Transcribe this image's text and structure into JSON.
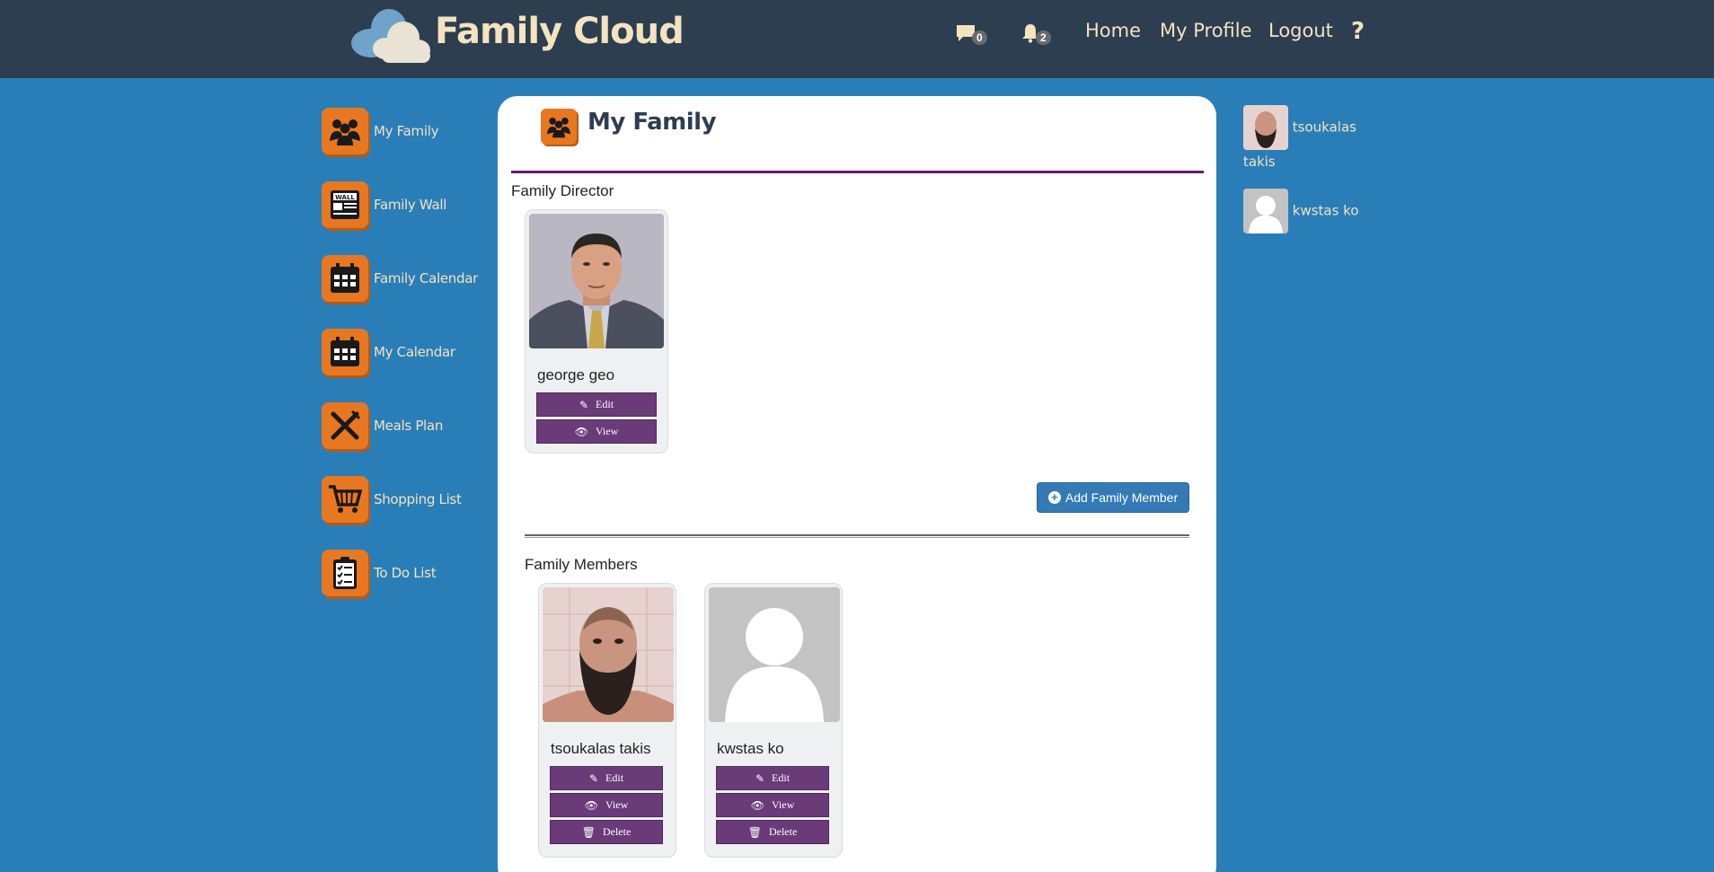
{
  "header": {
    "brand": "Family Cloud",
    "messages_count": "0",
    "notifications_count": "2",
    "nav": [
      "Home",
      "My Profile",
      "Logout"
    ],
    "help": "?"
  },
  "sidebar": {
    "items": [
      {
        "label": "My Family",
        "icon": "family-icon"
      },
      {
        "label": "Family Wall",
        "icon": "wall-icon"
      },
      {
        "label": "Family Calendar",
        "icon": "calendar-icon"
      },
      {
        "label": "My Calendar",
        "icon": "calendar-icon"
      },
      {
        "label": "Meals Plan",
        "icon": "utensils-icon"
      },
      {
        "label": "Shopping List",
        "icon": "cart-icon"
      },
      {
        "label": "To Do List",
        "icon": "checklist-icon"
      }
    ]
  },
  "main": {
    "title": "My Family",
    "director_label": "Family Director",
    "director": {
      "name": "george geo",
      "buttons": [
        "Edit",
        "View"
      ]
    },
    "add_member_label": "Add Family Member",
    "members_label": "Family Members",
    "members": [
      {
        "name": "tsoukalas takis",
        "buttons": [
          "Edit",
          "View",
          "Delete"
        ]
      },
      {
        "name": "kwstas ko",
        "buttons": [
          "Edit",
          "View",
          "Delete"
        ]
      }
    ]
  },
  "online": [
    {
      "first": "tsoukalas",
      "last": "takis"
    },
    {
      "first": "kwstas ko",
      "last": ""
    }
  ],
  "colors": {
    "accent_orange": "#e87722",
    "button_purple": "#6a3a79",
    "header_bg": "#2d3e50",
    "page_bg": "#2a7eb8",
    "text_cream": "#f3e3be"
  }
}
